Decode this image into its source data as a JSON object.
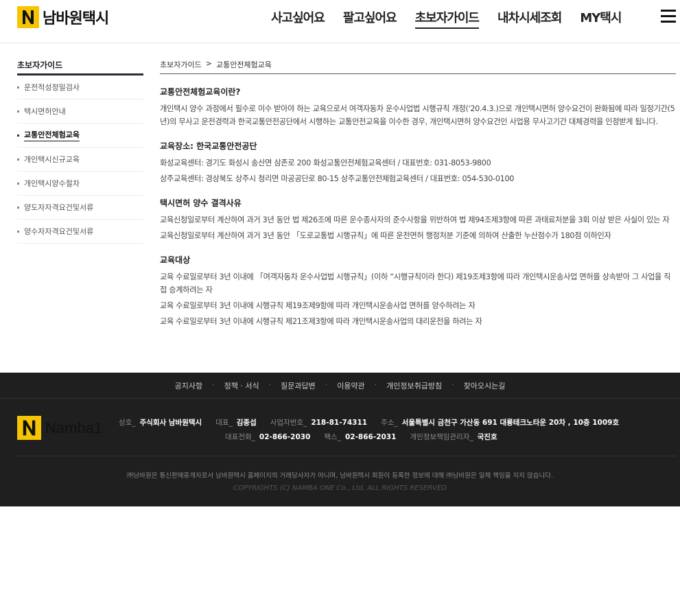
{
  "header": {
    "logo_text": "남바원택시",
    "nav": [
      "사고싶어요",
      "팔고싶어요",
      "초보자가이드",
      "내차시세조회",
      "MY택시"
    ],
    "active_nav": "초보자가이드"
  },
  "sidebar": {
    "title": "초보자가이드",
    "items": [
      {
        "label": "운전적성정밀검사"
      },
      {
        "label": "택시면허안내"
      },
      {
        "label": "교통안전체험교육"
      },
      {
        "label": "개인택시신규교육"
      },
      {
        "label": "개인택시양수절차"
      },
      {
        "label": "양도자자격요건및서류"
      },
      {
        "label": "양수자자격요건및서류"
      }
    ]
  },
  "breadcrumb": {
    "parent": "초보자가이드",
    "separator": ">",
    "current": "교통안전체험교육"
  },
  "content": {
    "sections": [
      {
        "title": "교통안전체험교육이란?",
        "paragraphs": [
          "개인택시 양수 과정에서 필수로 이수 받아야 하는 교육으로서 여객자동차 운수사업법 시행규칙 개정('20.4.3.)으로 개인택시면허 양수요건이 완화됨에 따라 일정기간(5년)의 무사고 운전경력과 한국교통안전공단에서 시행하는 교통안전교육을 이수한 경우, 개인택시면허 양수요건인 사업용 무사고기간 대체경력을 인정받게 됩니다."
        ]
      },
      {
        "title": "교육장소: 한국교통안전공단",
        "paragraphs": [
          "화성교육센터: 경기도 화성시 송산면 삼존로 200 화성교통안전체험교육센터 / 대표번호: 031-8053-9800",
          "상주교육센터: 경상북도 상주시 청리면 마공공단로 80-15 상주교통안전체험교육센터 / 대표번호: 054-530-0100"
        ]
      },
      {
        "title": "택시면허 양수 결격사유",
        "paragraphs": [
          "교육신청일로부터 계산하여 과거 3년 동안 법 제26조에 따른 운수종사자의 준수사항을 위반하여 법 제94조제3항에 따른 과태료처분을 3회 이상 받은 사실이 있는 자",
          "교육신청일로부터 계산하여 과거 3년 동안 「도로교통법 시행규칙」에 따른 운전면허 행정처분 기준에 의하여 산출한 누산점수가 180점 이하인자"
        ]
      },
      {
        "title": "교육대상",
        "paragraphs": [
          "교육 수료일로부터 3년 이내에 「여객자동차 운수사업법 시행규칙」(이하 “시행규칙이라 한다) 제19조제3항에 따라 개인택시운송사업 면허를 상속받아 그 사업을 직접 승계하려는 자",
          "교육 수료일로부터 3년 이내에 시행규칙 제19조제9항에 따라 개인택시운송사업 면허를 양수하려는 자",
          "교육 수료일로부터 3년 이내에 시행규칙 제21조제3항에 따라 개인택시운송사업의 대리운전을 하려는 자"
        ]
      }
    ]
  },
  "footer": {
    "links": [
      "공지사항",
      "정책 · 서식",
      "질문과답변",
      "이용약관",
      "개인정보취급방침",
      "찾아오시는길"
    ],
    "link_separator": "·",
    "logo_text": "Namba1",
    "info_row1": [
      {
        "key": "상호_",
        "value": "주식회사 남바원택시"
      },
      {
        "key": "대표_",
        "value": "김종섭"
      },
      {
        "key": "사업자번호_",
        "value": "218-81-74311"
      },
      {
        "key": "주소_",
        "value": "서울특별시 금천구 가산동 691 대륭테크노타운 20차 , 10층 1009호"
      }
    ],
    "info_row2": [
      {
        "key": "대표전화_",
        "value": "02-866-2030"
      },
      {
        "key": "팩스_",
        "value": "02-866-2031"
      },
      {
        "key": "개인정보책임관리자_",
        "value": "국진호"
      }
    ],
    "disclaimer": "㈜남바원은 통신판매중개자로서 남바원택시 홈페이지의 거래당사자가 아니며, 남바원택시 회원이 등록한 정보에 대해 ㈜남바원은 일체 책임을 지지 않습니다.",
    "copyright": "COPYRIGHTS (C) NAMBA ONE Co., Ltd. ALL RIGHTS RESERVED"
  },
  "colors": {
    "brand_yellow": "#f6c400",
    "footer_bg": "#1f1f1f",
    "text_dark": "#222222"
  }
}
